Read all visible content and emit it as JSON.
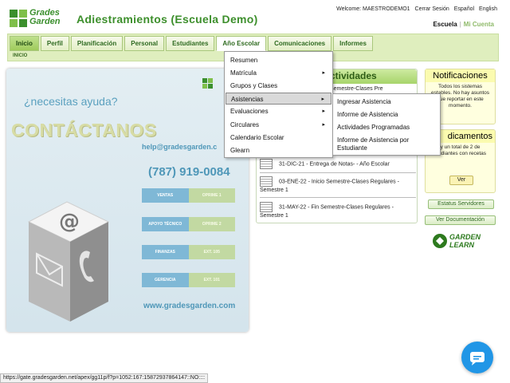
{
  "header": {
    "logo_line1": "Grades",
    "logo_line2": "Garden",
    "title": "Adiestramientos (Escuela Demo)",
    "welcome": "Welcome: MAESTRODEMO1",
    "logout": "Cerrar Sesión",
    "lang_es": "Español",
    "lang_en": "English",
    "school": "Escuela",
    "my_account": "Mi Cuenta"
  },
  "nav": {
    "tabs": [
      "Inicio",
      "Perfil",
      "Planificación",
      "Personal",
      "Estudiantes",
      "Año Escolar",
      "Comunicaciones",
      "Informes"
    ],
    "breadcrumb": "INICIO"
  },
  "dropdown": {
    "items": [
      "Resumen",
      "Matrícula",
      "Grupos y Clases",
      "Asistencias",
      "Evaluaciones",
      "Circulares",
      "Calendario Escolar",
      "Glearn"
    ],
    "arrow": "▸"
  },
  "submenu": {
    "items": [
      "Ingresar Asistencia",
      "Informe de Asistencia",
      "Actividades Programadas",
      "Informe de Asistencia por Estudiante"
    ]
  },
  "promo": {
    "need_help": "¿necesitas ayuda?",
    "contact": "CONTÁCTANOS",
    "email": "help@gradesgarden.c",
    "phone": "(787) 919-0084",
    "departments": [
      {
        "name": "VENTAS",
        "option": "OPRIME 1"
      },
      {
        "name": "APOYO TÉCNICO",
        "option": "OPRIME 2"
      },
      {
        "name": "FINANZAS",
        "option": "EXT. 105"
      },
      {
        "name": "GERENCIA",
        "option": "EXT. 101"
      }
    ],
    "website": "www.gradesgarden.com"
  },
  "activities": {
    "title": "ctividades",
    "items": [
      "Semestre-Clases Pre",
      "31-DIC-21 - Entrega de Notas- - Año Escolar",
      "03-ENE-22 - Inicio Semestre-Clases Regulares - Semestre 1",
      "31-MAY-22 - Fin Semestre-Clases Regulares - Semestre 1"
    ]
  },
  "notifications": {
    "title": "Notificaciones",
    "text": "Todos los sistemas estables. No hay asuntos que reportar en este momento."
  },
  "meds": {
    "title": "dicamentos",
    "text": "y un total de 2 de studiantes con recetas",
    "button": "Ver"
  },
  "side_buttons": {
    "status": "Estatus Servidores",
    "docs": "Ver Documentación"
  },
  "garden_learn": {
    "line1": "GARDEN",
    "line2": "LEARN"
  },
  "statusbar": "https://gate.gradesgarden.net/apex/gg11p/f?p=1052:167:15872937864147::NO::::",
  "colors": {
    "brand_green": "#3d8f2c",
    "nav_bg": "#dfeebe",
    "chat_blue": "#2196e6"
  }
}
